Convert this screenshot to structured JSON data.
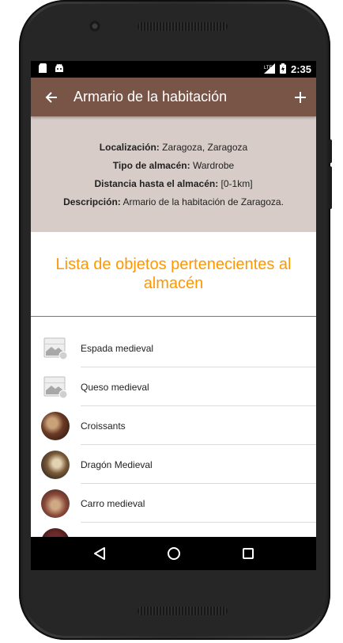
{
  "status_bar": {
    "time": "2:35",
    "network": "LTE"
  },
  "app_bar": {
    "title": "Armario de la habitación"
  },
  "info": {
    "location_label": "Localización:",
    "location_value": " Zaragoza, Zaragoza",
    "type_label": "Tipo de almacén:",
    "type_value": " Wardrobe",
    "distance_label": "Distancia hasta el almacén:",
    "distance_value": " [0-1km]",
    "description_label": "Descripción:",
    "description_value": " Armario de la habitación de Zaragoza."
  },
  "list_heading": "Lista de objetos pertenecientes al almacén",
  "items": [
    {
      "label": "Espada medieval",
      "image": "placeholder-image-icon"
    },
    {
      "label": "Queso medieval",
      "image": "placeholder-image-icon"
    },
    {
      "label": "Croissants",
      "image": "photo-avatar"
    },
    {
      "label": "Dragón Medieval",
      "image": "photo-avatar"
    },
    {
      "label": "Carro medieval",
      "image": "photo-avatar"
    },
    {
      "label": "",
      "image": "photo-avatar"
    }
  ],
  "colors": {
    "app_bar": "#795548",
    "info_background": "#d7ccc8",
    "heading_accent": "#ff9800"
  }
}
